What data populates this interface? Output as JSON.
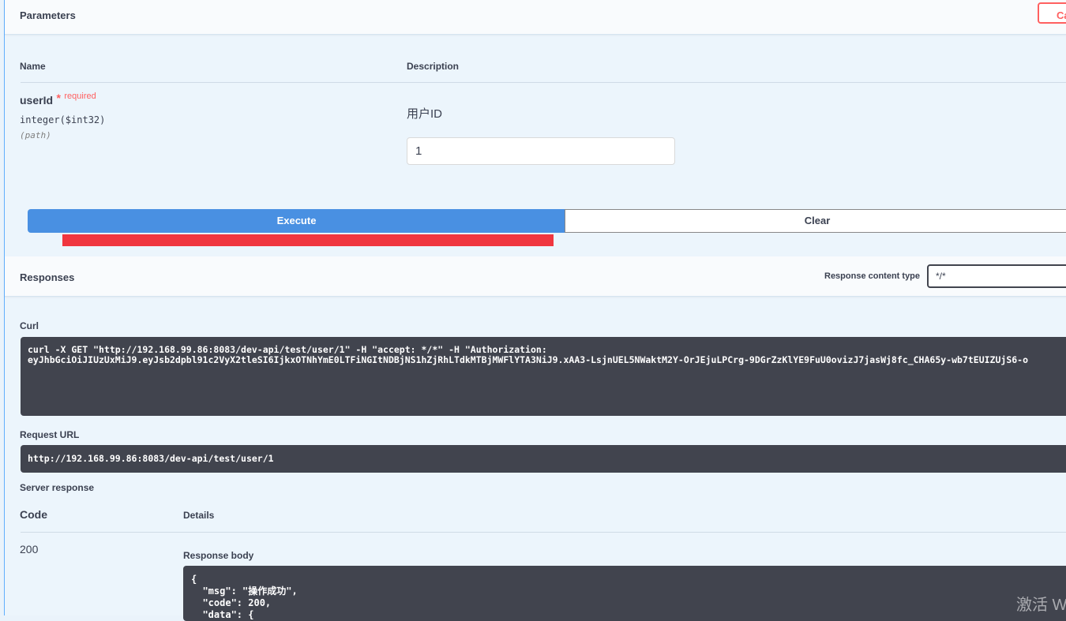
{
  "parameters": {
    "title": "Parameters",
    "cancel_label": "Ca",
    "col_name": "Name",
    "col_description": "Description",
    "param": {
      "name": "userId",
      "required_star": "*",
      "required_label": "required",
      "type": "integer($int32)",
      "location": "(path)",
      "description": "用户ID",
      "value": "1"
    },
    "execute_label": "Execute",
    "clear_label": "Clear"
  },
  "responses": {
    "title": "Responses",
    "content_type_label": "Response content type",
    "content_type_value": "*/*",
    "curl_label": "Curl",
    "curl_text": "curl -X GET \"http://192.168.99.86:8083/dev-api/test/user/1\" -H \"accept: */*\" -H \"Authorization: \neyJhbGciOiJIUzUxMiJ9.eyJsb2dpbl91c2VyX2tleSI6IjkxOTNhYmE0LTFiNGItNDBjNS1hZjRhLTdkMTBjMWFlYTA3NiJ9.xAA3-LsjnUEL5NWaktM2Y-OrJEjuLPCrg-9DGrZzKlYE9FuU0ovizJ7jasWj8fc_CHA65y-wb7tEUIZUjS6-o",
    "request_url_label": "Request URL",
    "request_url": "http://192.168.99.86:8083/dev-api/test/user/1",
    "server_response_label": "Server response",
    "col_code": "Code",
    "col_details": "Details",
    "code": "200",
    "response_body_label": "Response body",
    "response_body": "{\n  \"msg\": \"操作成功\",\n  \"code\": 200,\n  \"data\": {"
  },
  "watermark": "激活 W",
  "colors": {
    "execute": "#4990e2",
    "code_bg": "#41444e",
    "required": "#ff6060",
    "highlight": "#f0363f"
  }
}
